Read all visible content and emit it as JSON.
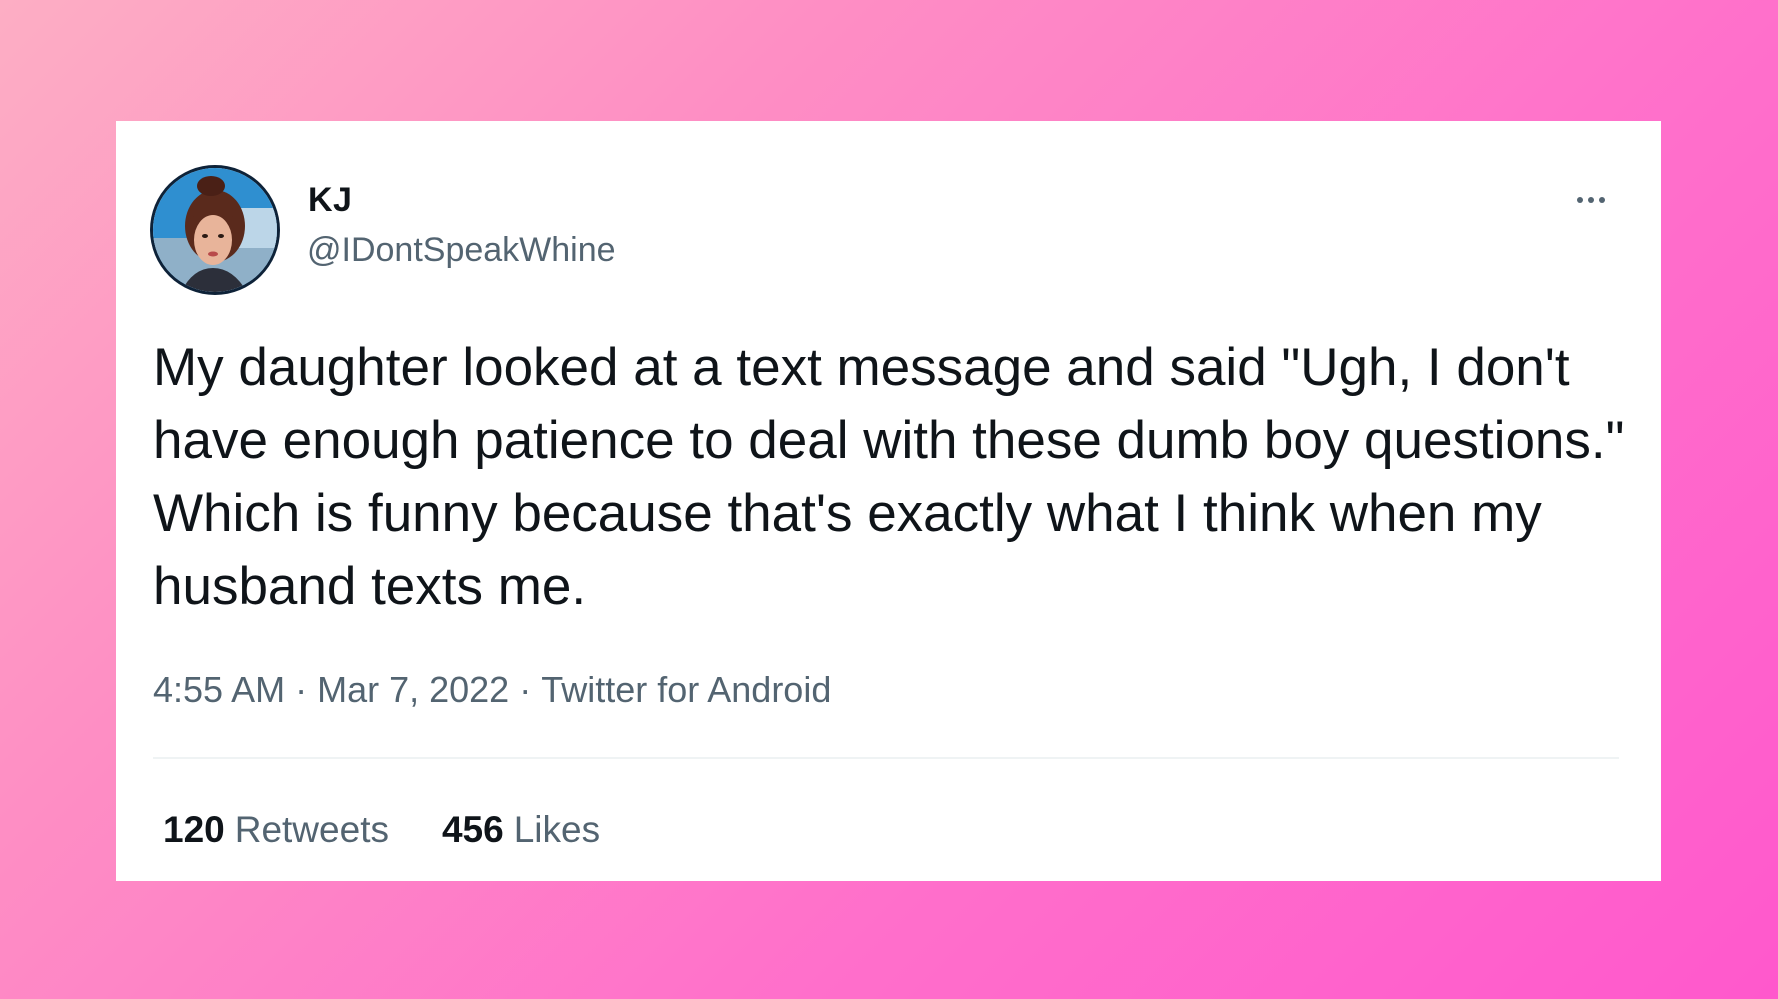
{
  "tweet": {
    "author": {
      "display_name": "KJ",
      "handle": "@IDontSpeakWhine"
    },
    "text": "My daughter looked at a text message and said \"Ugh, I don't have enough patience to deal with these dumb boy questions.\" Which is funny because that's exactly what I think when my husband texts me.",
    "time": "4:55 AM",
    "date": "Mar 7, 2022",
    "source": "Twitter for Android",
    "separator": "·",
    "stats": {
      "retweets_count": "120",
      "retweets_label": "Retweets",
      "likes_count": "456",
      "likes_label": "Likes"
    }
  },
  "icons": {
    "more": "more-horizontal-icon",
    "avatar": "profile-photo"
  },
  "colors": {
    "background_gradient_start": "#fdaec4",
    "background_gradient_end": "#ff58cc",
    "card_background": "#ffffff",
    "primary_text": "#0f1419",
    "secondary_text": "#536471",
    "divider": "#eff3f4"
  }
}
